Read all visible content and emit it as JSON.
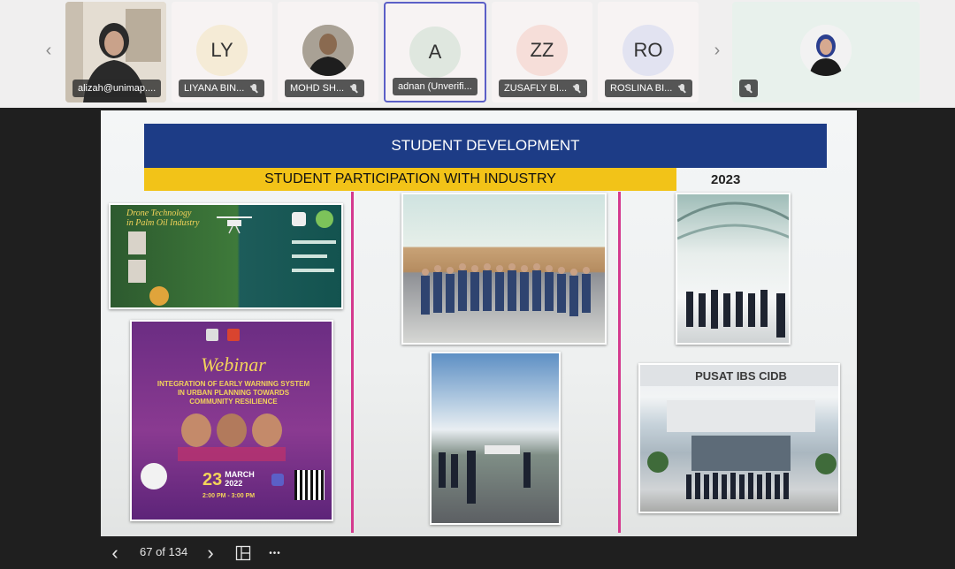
{
  "participants": [
    {
      "name": "alizah@unimap....",
      "initials": "",
      "type": "video"
    },
    {
      "name": "LIYANA BIN...",
      "initials": "LY",
      "bg": "#f5ebd6"
    },
    {
      "name": "MOHD SH...",
      "initials": "",
      "type": "photo"
    },
    {
      "name": "adnan (Unverifi...",
      "initials": "A",
      "bg": "#dfe7df",
      "active": true
    },
    {
      "name": "ZUSAFLY BI...",
      "initials": "ZZ",
      "bg": "#f6ded9"
    },
    {
      "name": "ROSLINA BI...",
      "initials": "RO",
      "bg": "#e2e3f1"
    },
    {
      "name": "",
      "initials": "",
      "type": "photo"
    }
  ],
  "slide": {
    "title": "STUDENT DEVELOPMENT",
    "subtitle": "STUDENT PARTICIPATION WITH INDUSTRY",
    "year": "2023",
    "poster1": {
      "title_line1": "Drone Technology",
      "title_line2": "in Palm Oil Industry"
    },
    "poster2": {
      "heading": "Webinar",
      "topic_line1": "INTEGRATION OF EARLY WARNING SYSTEM",
      "topic_line2": "IN URBAN PLANNING TOWARDS",
      "topic_line3": "COMMUNITY RESILIENCE",
      "date_day": "23",
      "date_month": "MARCH",
      "date_year": "2022",
      "time": "2:00 PM - 3:00 PM"
    },
    "building_sign": "PUSAT IBS CIDB"
  },
  "toolbar": {
    "page_indicator": "67 of 134",
    "prev_icon": "‹",
    "next_icon": "›",
    "more_icon": "•••"
  },
  "colors": {
    "header_blue": "#1d3c86",
    "header_yellow": "#f2c318",
    "divider_pink": "#d43a8e",
    "active_border": "#5b5fc7"
  }
}
